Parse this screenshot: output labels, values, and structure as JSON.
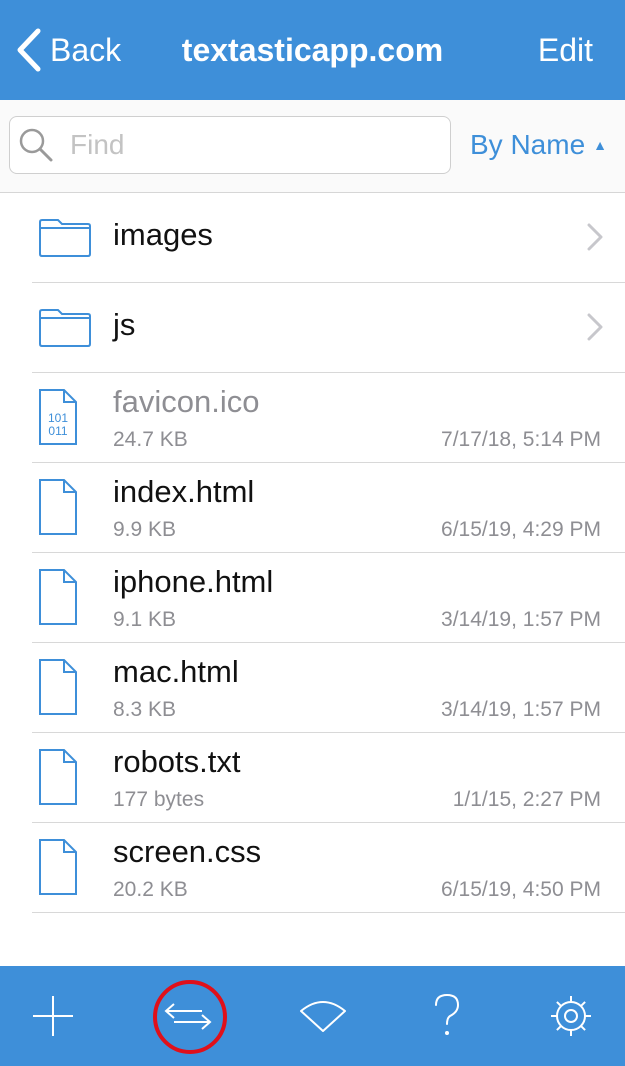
{
  "nav": {
    "back_label": "Back",
    "title": "textasticapp.com",
    "edit_label": "Edit"
  },
  "search": {
    "placeholder": "Find",
    "value": ""
  },
  "sort": {
    "label": "By Name",
    "direction": "ascending"
  },
  "folders": [
    {
      "name": "images"
    },
    {
      "name": "js"
    }
  ],
  "files": [
    {
      "name": "favicon.ico",
      "size": "24.7 KB",
      "date": "7/17/18, 5:14 PM",
      "kind": "binary",
      "dimmed": true
    },
    {
      "name": "index.html",
      "size": "9.9 KB",
      "date": "6/15/19, 4:29 PM",
      "kind": "text",
      "dimmed": false
    },
    {
      "name": "iphone.html",
      "size": "9.1 KB",
      "date": "3/14/19, 1:57 PM",
      "kind": "text",
      "dimmed": false
    },
    {
      "name": "mac.html",
      "size": "8.3 KB",
      "date": "3/14/19, 1:57 PM",
      "kind": "text",
      "dimmed": false
    },
    {
      "name": "robots.txt",
      "size": "177 bytes",
      "date": "1/1/15, 2:27 PM",
      "kind": "text",
      "dimmed": false
    },
    {
      "name": "screen.css",
      "size": "20.2 KB",
      "date": "6/15/19, 4:50 PM",
      "kind": "text",
      "dimmed": false
    }
  ],
  "toolbar": {
    "items": [
      {
        "icon": "plus-icon"
      },
      {
        "icon": "transfer-arrows-icon",
        "highlighted": true
      },
      {
        "icon": "wifi-icon"
      },
      {
        "icon": "help-icon"
      },
      {
        "icon": "gear-icon"
      }
    ]
  },
  "colors": {
    "accent": "#3e8fd9",
    "highlight_ring": "#e0101a",
    "secondary_text": "#8e8e93",
    "separator": "#d8d8d8"
  }
}
